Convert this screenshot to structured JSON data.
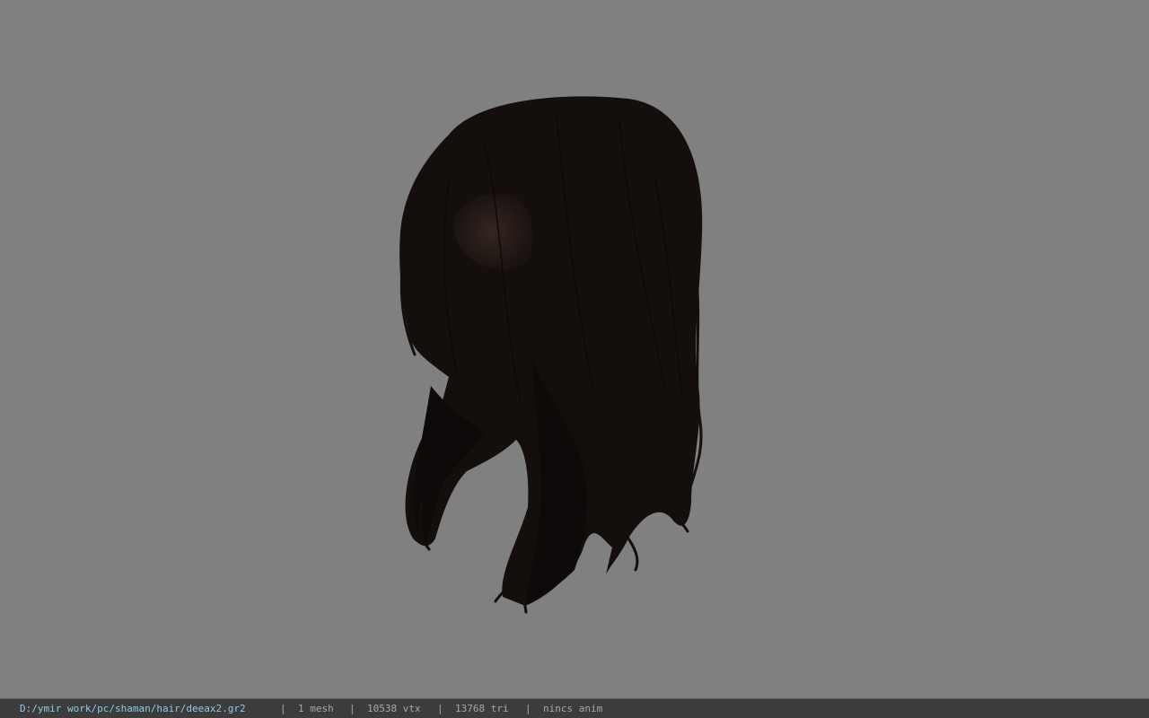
{
  "viewport": {
    "background_color": "#808080",
    "model_name": "hair-mesh",
    "hair_color": "#140f0d"
  },
  "status_bar": {
    "file_path": "D:/ymir work/pc/shaman/hair/deeax2.gr2",
    "separator": "|",
    "mesh_count": "1 mesh",
    "vertex_count": "10538 vtx",
    "triangle_count": "13768 tri",
    "anim_status": "nincs anim",
    "path_color": "#8ecbe6",
    "text_color": "#a8a8a8"
  }
}
